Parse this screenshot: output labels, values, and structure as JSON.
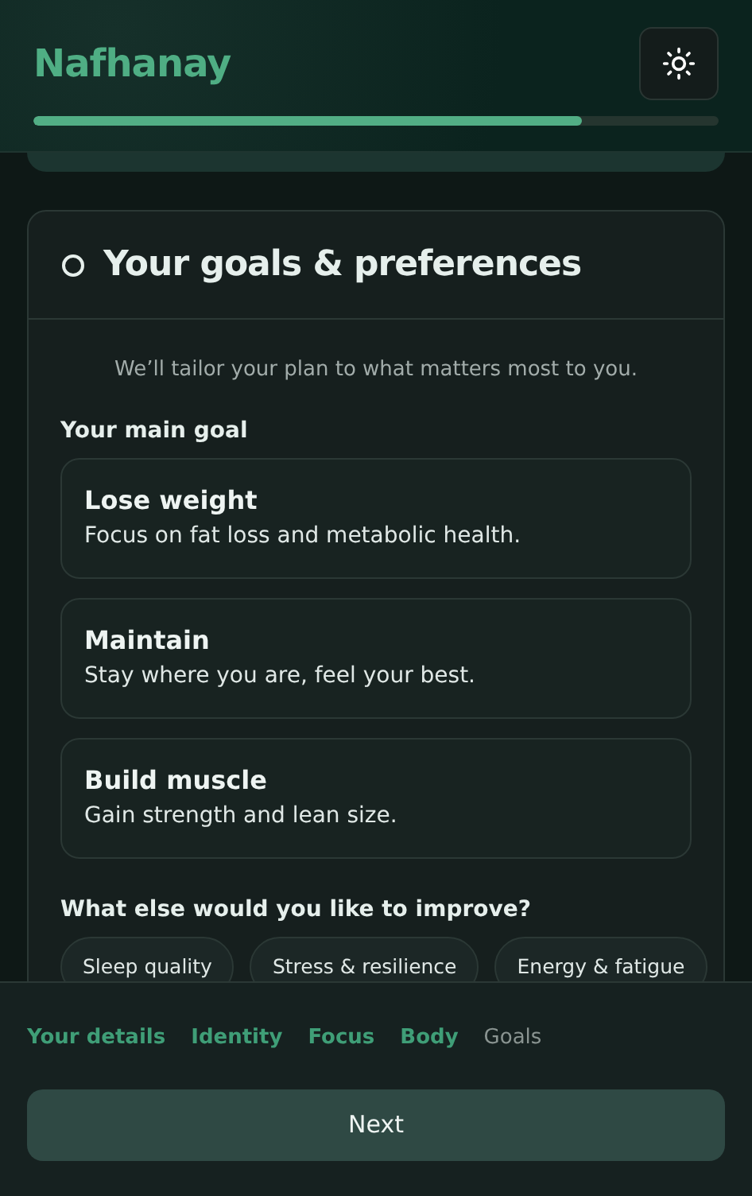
{
  "app": {
    "name": "Nafhanay",
    "progress": {
      "level": 0.8
    }
  },
  "section": {
    "title": "Your goals & preferences",
    "done": false,
    "intro": "We’ll tailor your plan to what matters most to you.",
    "main_goal": {
      "label": "Your main goal",
      "options": [
        {
          "title": "Lose weight",
          "description": "Focus on fat loss and metabolic health.",
          "selected": false
        },
        {
          "title": "Maintain",
          "description": "Stay where you are, feel your best.",
          "selected": false
        },
        {
          "title": "Build muscle",
          "description": "Gain strength and lean size.",
          "selected": false
        }
      ]
    },
    "improve": {
      "label": "What else would you like to improve?",
      "chips": [
        {
          "label": "Sleep quality",
          "selected": false
        },
        {
          "label": "Stress & resilience",
          "selected": false
        },
        {
          "label": "Energy & fatigue",
          "selected": false
        }
      ]
    }
  },
  "steps": [
    {
      "label": "Your details",
      "done": true
    },
    {
      "label": "Identity",
      "done": true
    },
    {
      "label": "Focus",
      "done": true
    },
    {
      "label": "Body",
      "done": true
    },
    {
      "label": "Goals",
      "done": false
    }
  ],
  "next_button": "Next"
}
